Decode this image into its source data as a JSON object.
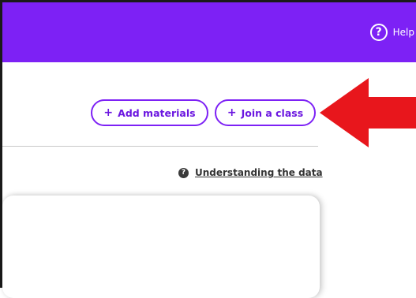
{
  "header": {
    "help_label": "Help",
    "help_icon": "question-circle-icon",
    "color": "#7d21f5"
  },
  "actions": {
    "add_materials": {
      "icon": "plus-icon",
      "label": "Add materials"
    },
    "join_class": {
      "icon": "plus-icon",
      "label": "Join a class"
    }
  },
  "links": {
    "understanding_data": {
      "icon": "question-circle-icon",
      "label": "Understanding the data"
    }
  },
  "annotation": {
    "arrow_color": "#e8161c",
    "arrow_direction": "left"
  }
}
